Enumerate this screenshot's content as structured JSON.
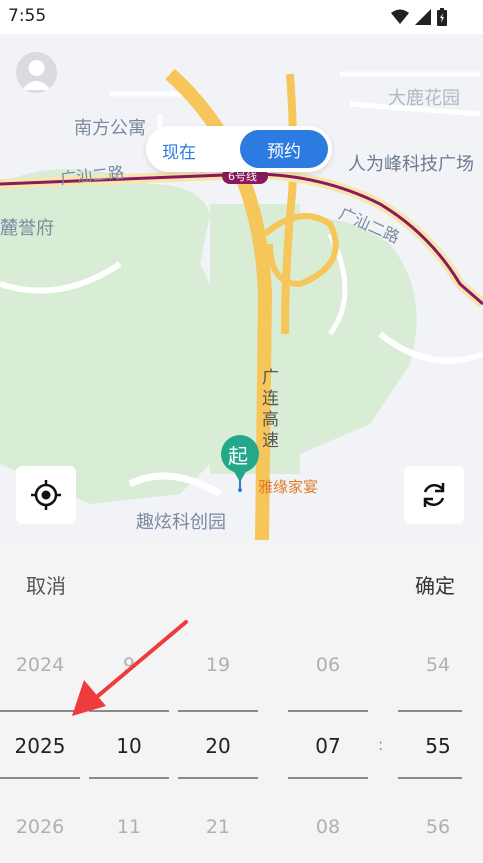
{
  "status": {
    "time": "7:55"
  },
  "map": {
    "labels": {
      "nanfang": "南方公寓",
      "guangshan_a": "广汕二路",
      "guangshan_b": "广汕二路",
      "line6": "6号线",
      "renweifeng": "人为峰科技广场",
      "daluhuayuan": "大鹿花园",
      "luyufu": "麓誉府",
      "guanglian": [
        "广",
        "连",
        "高",
        "速"
      ],
      "quxuan": "趣炫科创园",
      "yayuan": "雅缘家宴"
    },
    "marker_text": "起"
  },
  "mode_toggle": {
    "now": "现在",
    "book": "预约"
  },
  "sheet": {
    "cancel": "取消",
    "confirm": "确定",
    "wheels": [
      {
        "prev": "2024",
        "current": "2025",
        "next": "2026"
      },
      {
        "prev": "9",
        "current": "10",
        "next": "11"
      },
      {
        "prev": "19",
        "current": "20",
        "next": "21"
      },
      {
        "prev": "06",
        "current": "07",
        "next": "08"
      },
      {
        "prev": "54",
        "current": "55",
        "next": "56"
      }
    ],
    "separator": ":"
  },
  "colors": {
    "accent": "#2b7be0",
    "road": "#f7c65a",
    "metro": "#8a1a5c",
    "park": "#d9ecd6"
  }
}
